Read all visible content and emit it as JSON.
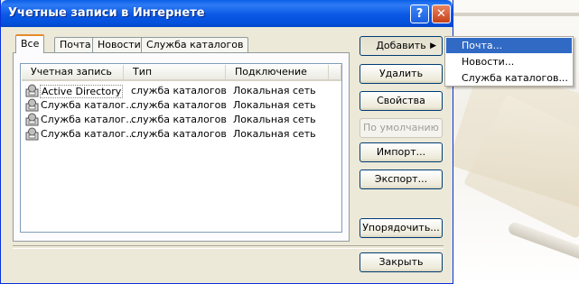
{
  "window": {
    "title": "Учетные записи в Интернете",
    "help": "?",
    "close": "✕"
  },
  "tabs": [
    {
      "label": "Все"
    },
    {
      "label": "Почта"
    },
    {
      "label": "Новости"
    },
    {
      "label": "Служба каталогов"
    }
  ],
  "columns": [
    "Учетная запись",
    "Тип",
    "Подключение"
  ],
  "rows": [
    {
      "name": "Active Directory",
      "type": "служба каталогов",
      "connection": "Локальная сеть"
    },
    {
      "name": "Служба каталог...",
      "type": "служба каталогов",
      "connection": "Локальная сеть"
    },
    {
      "name": "Служба каталог...",
      "type": "служба каталогов",
      "connection": "Локальная сеть"
    },
    {
      "name": "Служба каталог...",
      "type": "служба каталогов",
      "connection": "Локальная сеть"
    }
  ],
  "buttons": {
    "add": "Добавить",
    "add_arrow": "▶",
    "remove": "Удалить",
    "properties": "Свойства",
    "default": "По умолчанию",
    "import": "Импорт...",
    "export": "Экспорт...",
    "order": "Упорядочить...",
    "close": "Закрыть"
  },
  "add_menu": [
    "Почта...",
    "Новости...",
    "Служба каталогов..."
  ]
}
